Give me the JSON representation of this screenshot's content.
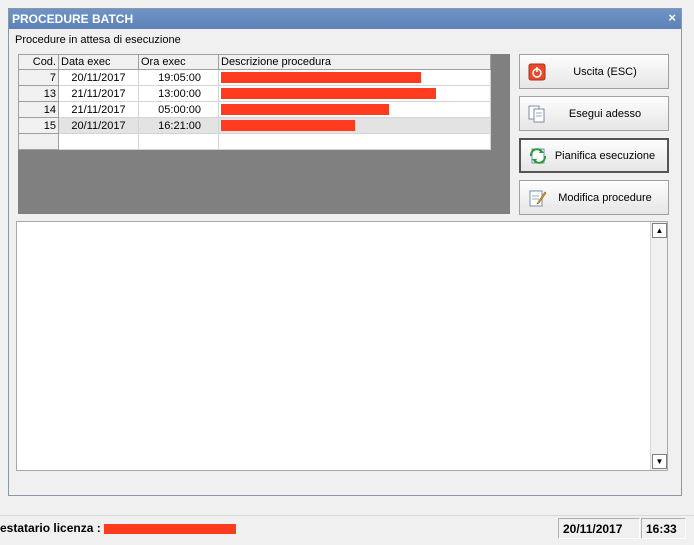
{
  "window": {
    "title": "PROCEDURE BATCH",
    "close_glyph": "×"
  },
  "subtitle": "Procedure in attesa di esecuzione",
  "grid": {
    "columns": [
      "Cod.",
      "Data exec",
      "Ora exec",
      "Descrizione procedura"
    ],
    "rows": [
      {
        "code": "7",
        "date": "20/11/2017",
        "time": "19:05:00"
      },
      {
        "code": "13",
        "date": "21/11/2017",
        "time": "13:00:00"
      },
      {
        "code": "14",
        "date": "21/11/2017",
        "time": "05:00:00"
      },
      {
        "code": "15",
        "date": "20/11/2017",
        "time": "16:21:00"
      }
    ]
  },
  "buttons": {
    "exit": {
      "label": "Uscita (ESC)",
      "icon": "power-icon"
    },
    "run_now": {
      "label": "Esegui adesso",
      "icon": "run-documents-icon"
    },
    "schedule": {
      "label": "Pianifica esecuzione",
      "icon": "schedule-refresh-icon"
    },
    "edit": {
      "label": "Modifica procedure",
      "icon": "edit-document-icon"
    }
  },
  "statusbar": {
    "license_label": "estatario licenza :",
    "date": "20/11/2017",
    "time": "16:33"
  },
  "colors": {
    "titlebar": "#5d82b8",
    "redaction": "#ff3b1f",
    "grid_background": "#808080"
  }
}
